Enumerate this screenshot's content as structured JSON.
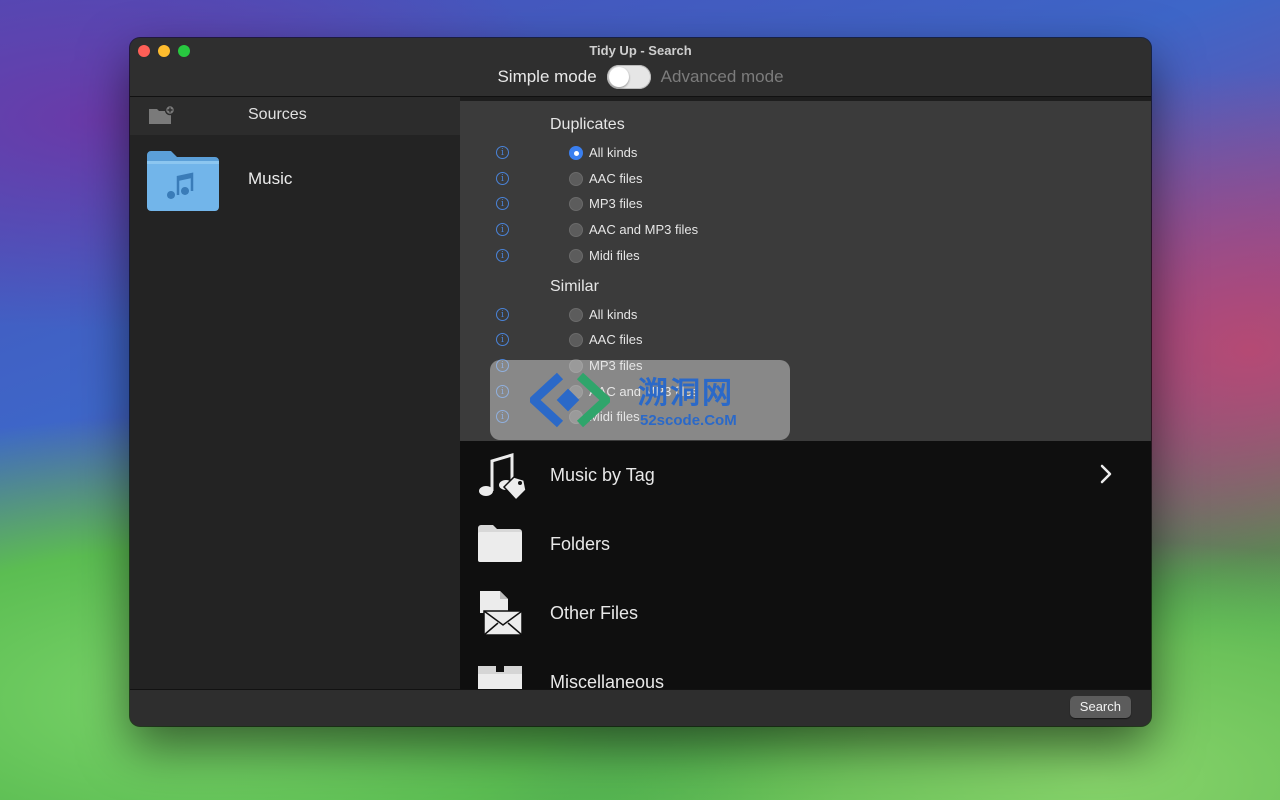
{
  "window": {
    "title": "Tidy Up - Search",
    "mode_simple": "Simple mode",
    "mode_advanced": "Advanced mode",
    "simple_mode_on": true
  },
  "sidebar": {
    "header_label": "Sources",
    "add_icon": "folder-add-icon",
    "items": [
      {
        "label": "Music",
        "icon": "music-folder-icon"
      }
    ]
  },
  "options": {
    "groups": [
      {
        "title": "Duplicates",
        "items": [
          {
            "label": "All kinds",
            "selected": true
          },
          {
            "label": "AAC files",
            "selected": false
          },
          {
            "label": "MP3 files",
            "selected": false
          },
          {
            "label": "AAC and MP3 files",
            "selected": false
          },
          {
            "label": "Midi files",
            "selected": false
          }
        ]
      },
      {
        "title": "Similar",
        "items": [
          {
            "label": "All kinds",
            "selected": false
          },
          {
            "label": "AAC files",
            "selected": false
          },
          {
            "label": "MP3 files",
            "selected": false
          },
          {
            "label": "AAC and MP3 files",
            "selected": false
          },
          {
            "label": "Midi files",
            "selected": false
          }
        ]
      }
    ]
  },
  "categories": [
    {
      "label": "Music by Tag",
      "icon": "music-tag-icon",
      "has_chevron": true
    },
    {
      "label": "Folders",
      "icon": "folder-icon",
      "has_chevron": false
    },
    {
      "label": "Other Files",
      "icon": "document-envelope-icon",
      "has_chevron": false
    },
    {
      "label": "Miscellaneous",
      "icon": "box-icon",
      "has_chevron": false
    }
  ],
  "footer": {
    "search_label": "Search"
  },
  "watermark": {
    "text_cn": "溯洞网",
    "text_en": "52scode.CoM"
  },
  "colors": {
    "accent": "#3a7ff0",
    "info": "#4a83d8",
    "folder_blue": "#72b5ea"
  }
}
